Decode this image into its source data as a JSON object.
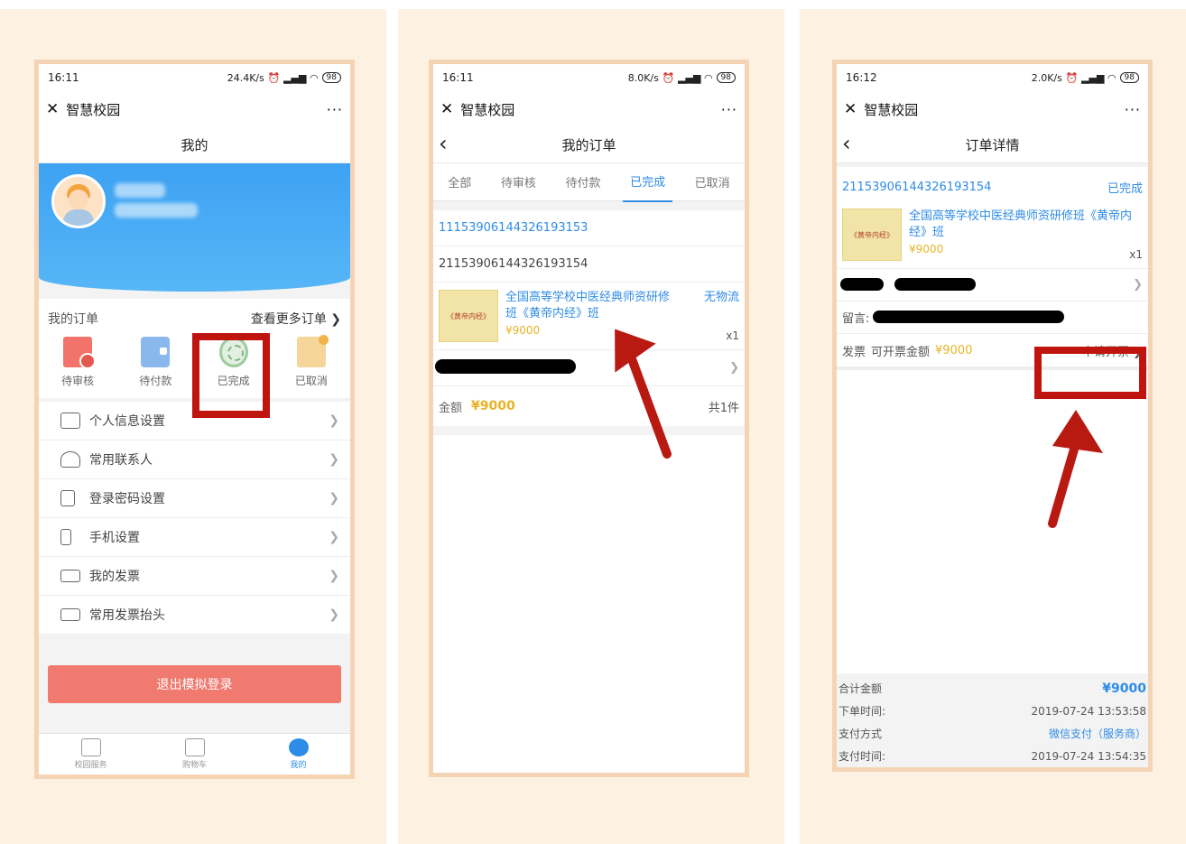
{
  "panel1": {
    "status": {
      "time": "16:11",
      "net": "24.4K/s",
      "battery": "98"
    },
    "app_title": "智慧校园",
    "nav_title": "我的",
    "orders_title": "我的订单",
    "orders_more": "查看更多订单",
    "order_icons": [
      {
        "label": "待审核",
        "icon": "pending-review-icon"
      },
      {
        "label": "待付款",
        "icon": "wallet-icon"
      },
      {
        "label": "已完成",
        "icon": "completed-stamp-icon"
      },
      {
        "label": "已取消",
        "icon": "cancelled-clipboard-icon"
      }
    ],
    "menu": [
      "个人信息设置",
      "常用联系人",
      "登录密码设置",
      "手机设置",
      "我的发票",
      "常用发票抬头"
    ],
    "logout": "退出模拟登录",
    "tabs": [
      "校园服务",
      "购物车",
      "我的"
    ]
  },
  "panel2": {
    "status": {
      "time": "16:11",
      "net": "8.0K/s",
      "battery": "98"
    },
    "app_title": "智慧校园",
    "nav_title": "我的订单",
    "tabs": [
      "全部",
      "待审核",
      "待付款",
      "已完成",
      "已取消"
    ],
    "active_tab": "已完成",
    "order_no_1": "11153906144326193153",
    "order_no_2": "21153906144326193154",
    "product_title": "全国高等学校中医经典师资研修班《黄帝内经》班",
    "logistics": "无物流",
    "price": "¥9000",
    "qty": "x1",
    "amount_label": "金额",
    "amount_value": "¥9000",
    "count": "共1件"
  },
  "panel3": {
    "status": {
      "time": "16:12",
      "net": "2.0K/s",
      "battery": "98"
    },
    "app_title": "智慧校园",
    "nav_title": "订单详情",
    "order_no": "21153906144326193154",
    "order_status": "已完成",
    "product_title": "全国高等学校中医经典师资研修班《黄帝内经》班",
    "price": "¥9000",
    "qty": "x1",
    "message_label": "留言:",
    "invoice_label": "发票",
    "invoice_amount_label": "可开票金额",
    "invoice_amount": "¥9000",
    "apply_invoice": "申请开票",
    "total_label": "合计金额",
    "total_value": "¥9000",
    "order_time_label": "下单时间:",
    "order_time": "2019-07-24 13:53:58",
    "pay_method_label": "支付方式",
    "pay_method": "微信支付（服务商）",
    "pay_time_label": "支付时间:",
    "pay_time": "2019-07-24 13:54:35"
  },
  "book_cover_text": "《黄帝内经》",
  "colors": {
    "accent_blue": "#2f8ce6",
    "highlight_red": "#c0150f",
    "price_gold": "#e8b326",
    "logout_red": "#f07a6f"
  }
}
